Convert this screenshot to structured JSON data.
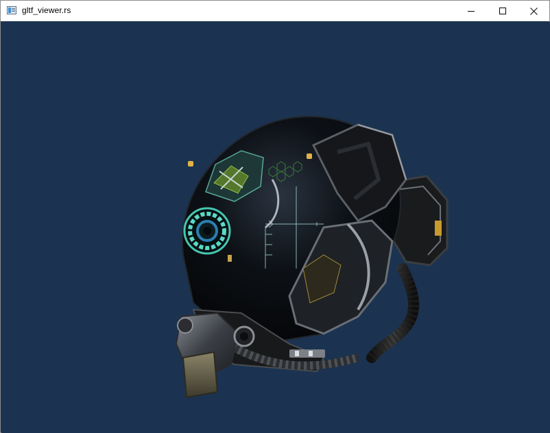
{
  "window": {
    "title": "gltf_viewer.rs",
    "background_color": "#1b3350",
    "controls": {
      "minimize_icon": "minimize-icon",
      "maximize_icon": "maximize-icon",
      "close_icon": "close-icon"
    }
  },
  "scene": {
    "model_icon": "helmet-model"
  }
}
